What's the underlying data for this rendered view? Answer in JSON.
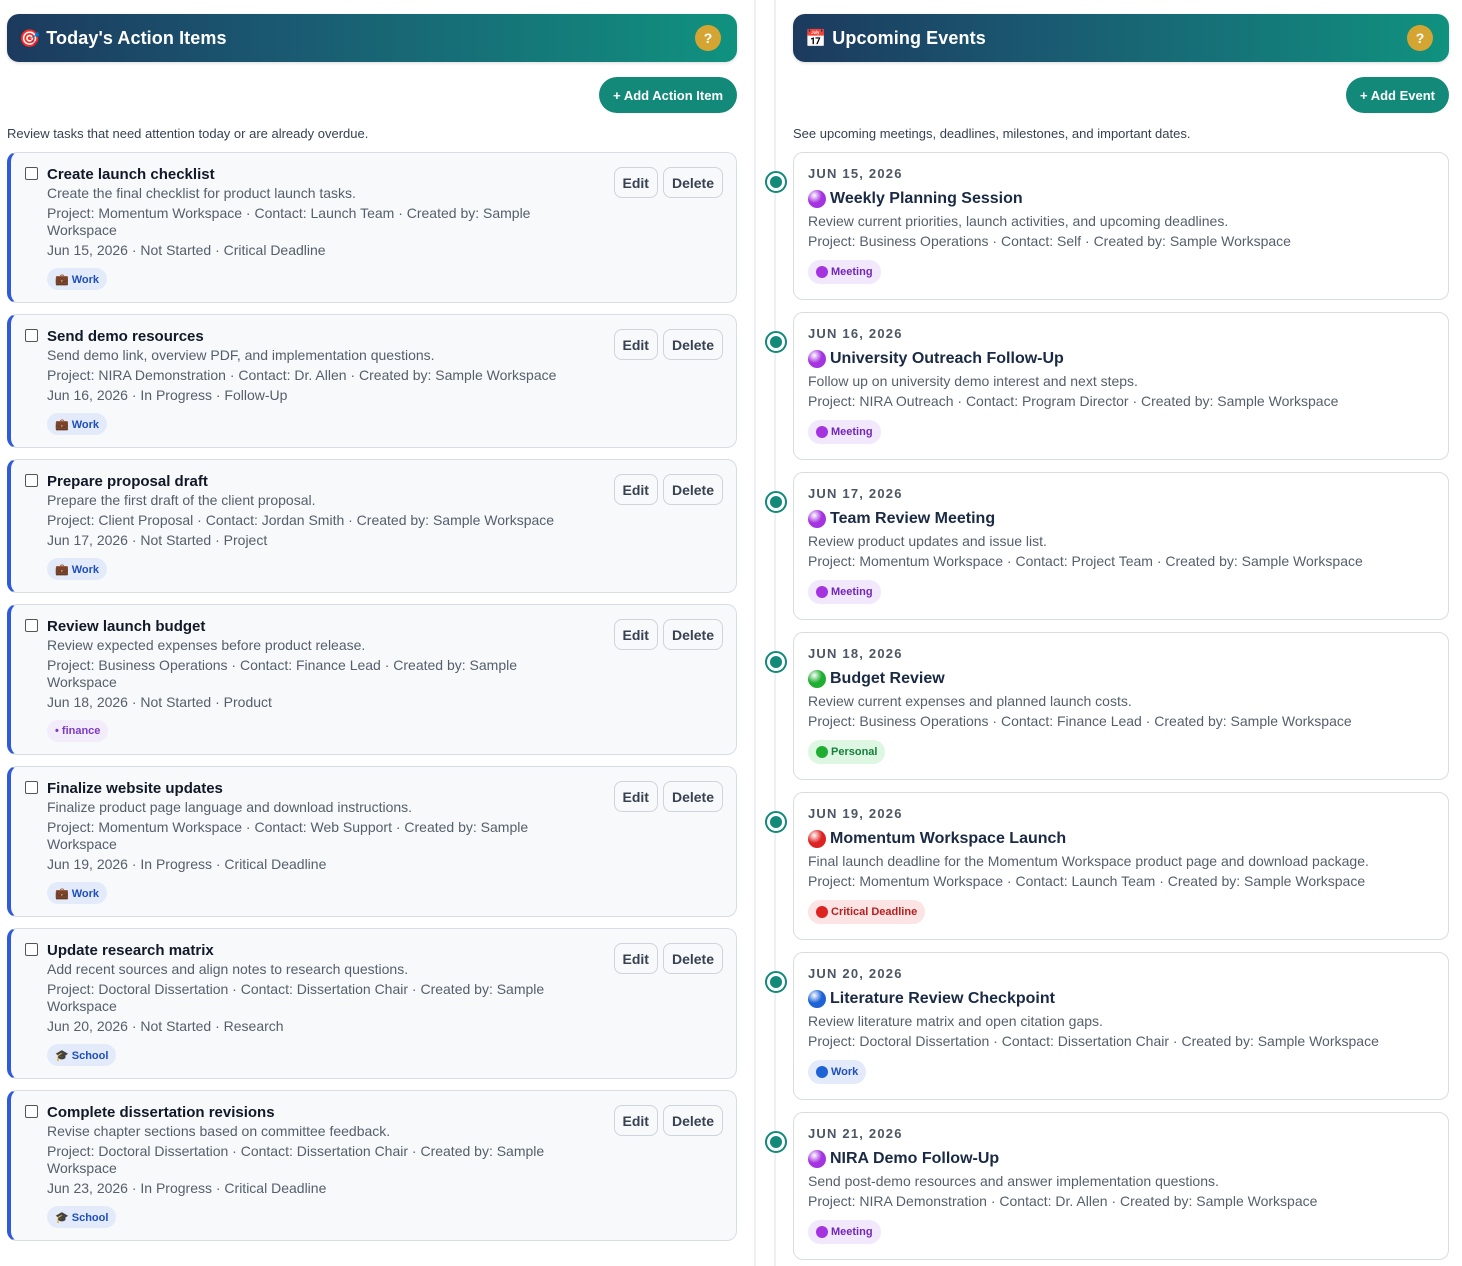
{
  "colors": {
    "accent": "#13897a",
    "help": "#d4a533",
    "task_border": "#2f5bd8",
    "purple": "#a433e0",
    "green": "#1fae32",
    "red": "#dd2222",
    "blue": "#1e63d6"
  },
  "left": {
    "icon": "dart-target-icon",
    "title": "Today's Action Items",
    "help": "?",
    "add_label": "+ Add Action Item",
    "description": "Review tasks that need attention today or are already overdue.",
    "tasks": [
      {
        "title": "Create launch checklist",
        "desc": "Create the final checklist for product launch tasks.",
        "meta": "Project: Momentum Workspace · Contact: Launch Team · Created by: Sample Workspace",
        "status": "Jun 15, 2026 · Not Started · Critical Deadline",
        "tag": "💼 Work",
        "edit": "Edit",
        "delete": "Delete"
      },
      {
        "title": "Send demo resources",
        "desc": "Send demo link, overview PDF, and implementation questions.",
        "meta": "Project: NIRA Demonstration · Contact: Dr. Allen · Created by: Sample Workspace",
        "status": "Jun 16, 2026 · In Progress · Follow-Up",
        "tag": "💼 Work",
        "edit": "Edit",
        "delete": "Delete"
      },
      {
        "title": "Prepare proposal draft",
        "desc": "Prepare the first draft of the client proposal.",
        "meta": "Project: Client Proposal · Contact: Jordan Smith · Created by: Sample Workspace",
        "status": "Jun 17, 2026 · Not Started · Project",
        "tag": "💼 Work",
        "edit": "Edit",
        "delete": "Delete"
      },
      {
        "title": "Review launch budget",
        "desc": "Review expected expenses before product release.",
        "meta": "Project: Business Operations · Contact: Finance Lead · Created by: Sample Workspace",
        "status": "Jun 18, 2026 · Not Started · Product",
        "tag": "• finance",
        "edit": "Edit",
        "delete": "Delete"
      },
      {
        "title": "Finalize website updates",
        "desc": "Finalize product page language and download instructions.",
        "meta": "Project: Momentum Workspace · Contact: Web Support · Created by: Sample Workspace",
        "status": "Jun 19, 2026 · In Progress · Critical Deadline",
        "tag": "💼 Work",
        "edit": "Edit",
        "delete": "Delete"
      },
      {
        "title": "Update research matrix",
        "desc": "Add recent sources and align notes to research questions.",
        "meta": "Project: Doctoral Dissertation · Contact: Dissertation Chair · Created by: Sample Workspace",
        "status": "Jun 20, 2026 · Not Started · Research",
        "tag": "🎓 School",
        "edit": "Edit",
        "delete": "Delete"
      },
      {
        "title": "Complete dissertation revisions",
        "desc": "Revise chapter sections based on committee feedback.",
        "meta": "Project: Doctoral Dissertation · Contact: Dissertation Chair · Created by: Sample Workspace",
        "status": "Jun 23, 2026 · In Progress · Critical Deadline",
        "tag": "🎓 School",
        "edit": "Edit",
        "delete": "Delete"
      }
    ]
  },
  "right": {
    "icon": "calendar-icon",
    "title": "Upcoming Events",
    "help": "?",
    "add_label": "+ Add Event",
    "description": "See upcoming meetings, deadlines, milestones, and important dates.",
    "events": [
      {
        "date": "JUN 15, 2026",
        "title": "Weekly Planning Session",
        "desc": "Review current priorities, launch activities, and upcoming deadlines.",
        "meta": "Project: Business Operations · Contact: Self · Created by: Sample Workspace",
        "tag": "Meeting",
        "kind": "meeting"
      },
      {
        "date": "JUN 16, 2026",
        "title": "University Outreach Follow-Up",
        "desc": "Follow up on university demo interest and next steps.",
        "meta": "Project: NIRA Outreach · Contact: Program Director · Created by: Sample Workspace",
        "tag": "Meeting",
        "kind": "meeting"
      },
      {
        "date": "JUN 17, 2026",
        "title": "Team Review Meeting",
        "desc": "Review product updates and issue list.",
        "meta": "Project: Momentum Workspace · Contact: Project Team · Created by: Sample Workspace",
        "tag": "Meeting",
        "kind": "meeting"
      },
      {
        "date": "JUN 18, 2026",
        "title": "Budget Review",
        "desc": "Review current expenses and planned launch costs.",
        "meta": "Project: Business Operations · Contact: Finance Lead · Created by: Sample Workspace",
        "tag": "Personal",
        "kind": "personal"
      },
      {
        "date": "JUN 19, 2026",
        "title": "Momentum Workspace Launch",
        "desc": "Final launch deadline for the Momentum Workspace product page and download package.",
        "meta": "Project: Momentum Workspace · Contact: Launch Team · Created by: Sample Workspace",
        "tag": "Critical Deadline",
        "kind": "critical"
      },
      {
        "date": "JUN 20, 2026",
        "title": "Literature Review Checkpoint",
        "desc": "Review literature matrix and open citation gaps.",
        "meta": "Project: Doctoral Dissertation · Contact: Dissertation Chair · Created by: Sample Workspace",
        "tag": "Work",
        "kind": "work"
      },
      {
        "date": "JUN 21, 2026",
        "title": "NIRA Demo Follow-Up",
        "desc": "Send post-demo resources and answer implementation questions.",
        "meta": "Project: NIRA Demonstration · Contact: Dr. Allen · Created by: Sample Workspace",
        "tag": "Meeting",
        "kind": "meeting"
      }
    ]
  }
}
